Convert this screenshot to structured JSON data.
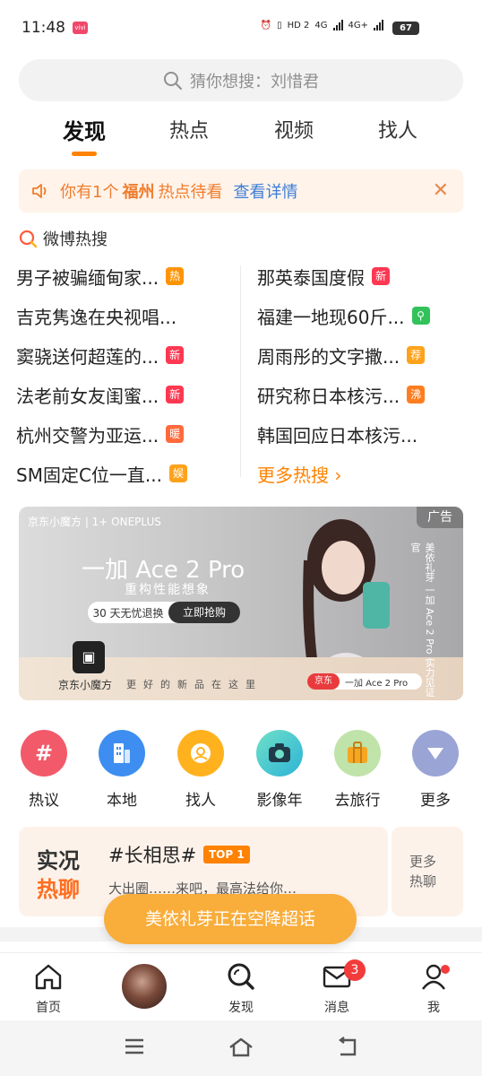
{
  "status_bar": {
    "time": "11:48",
    "app_badge": "vivi",
    "network_1": "HD 2",
    "network_2": "4G",
    "network_3": "4G+",
    "battery": "67"
  },
  "search": {
    "placeholder": "猜你想搜：刘惜君"
  },
  "tabs": [
    {
      "label": "发现",
      "active": true
    },
    {
      "label": "热点",
      "active": false
    },
    {
      "label": "视频",
      "active": false
    },
    {
      "label": "找人",
      "active": false
    }
  ],
  "notice": {
    "prefix": "你有1个",
    "city": "福州",
    "suffix": "热点待看",
    "link": "查看详情",
    "close": "✕"
  },
  "hot_search": {
    "title": "微博热搜",
    "left": [
      {
        "text": "男子被骗缅甸家...",
        "badge": "热",
        "badge_color": "#ff9406"
      },
      {
        "text": "吉克隽逸在央视唱...",
        "badge": "",
        "badge_color": ""
      },
      {
        "text": "窦骁送何超莲的...",
        "badge": "新",
        "badge_color": "#ff3852"
      },
      {
        "text": "法老前女友闺蜜...",
        "badge": "新",
        "badge_color": "#ff3852"
      },
      {
        "text": "杭州交警为亚运...",
        "badge": "暖",
        "badge_color": "#ff6a3c"
      },
      {
        "text": "SM固定C位一直...",
        "badge": "娱",
        "badge_color": "#ffa21b"
      }
    ],
    "right": [
      {
        "text": "那英泰国度假",
        "badge": "新",
        "badge_color": "#ff3852"
      },
      {
        "text": "福建一地现60斤...",
        "badge": "⚲",
        "badge_color": "#32c25a"
      },
      {
        "text": "周雨彤的文字撒...",
        "badge": "荐",
        "badge_color": "#ffa21b"
      },
      {
        "text": "研究称日本核污...",
        "badge": "沸",
        "badge_color": "#ff7d1f"
      },
      {
        "text": "韩国回应日本核污...",
        "badge": "",
        "badge_color": ""
      }
    ],
    "more": "更多热搜 ›"
  },
  "banner": {
    "ad_tag": "广告",
    "brand": "京东小魔方 | 1+ ONEPLUS",
    "title": "一加 Ace 2 Pro",
    "subtitle": "重构性能想象",
    "pill_left": "30 天无忧退换",
    "pill_right": "立即抢购",
    "logo_text": "京东小魔方",
    "slogan": "更好的新品在这里",
    "vertical_text": "美依礼芽 一加 Ace 2 Pro 实力见证官",
    "jd_tag": "京东",
    "jd_product": "一加 Ace 2 Pro"
  },
  "quick_entries": [
    {
      "label": "热议",
      "icon": "hash-icon",
      "color": "#f25a6a"
    },
    {
      "label": "本地",
      "icon": "building-icon",
      "color": "#3d8ef0"
    },
    {
      "label": "找人",
      "icon": "person-search-icon",
      "color": "#ffb21e"
    },
    {
      "label": "影像年",
      "icon": "camera-icon",
      "color": "#34c7b0"
    },
    {
      "label": "去旅行",
      "icon": "suitcase-icon",
      "color": "#f5a623"
    },
    {
      "label": "更多",
      "icon": "chevron-down-icon",
      "color": "#9aa5d6"
    }
  ],
  "live_chat": {
    "title_line1": "实况",
    "title_line2": "热聊",
    "topic": "#长相思#",
    "topic_badge": "TOP 1",
    "snippet": "大出圈……来吧，最高法给你…",
    "more_line1": "更多",
    "more_line2": "热聊"
  },
  "toast": "美依礼芽正在空降超话",
  "bottom_nav": {
    "home": "首页",
    "discover": "发现",
    "messages": "消息",
    "messages_count": "3",
    "me": "我"
  }
}
